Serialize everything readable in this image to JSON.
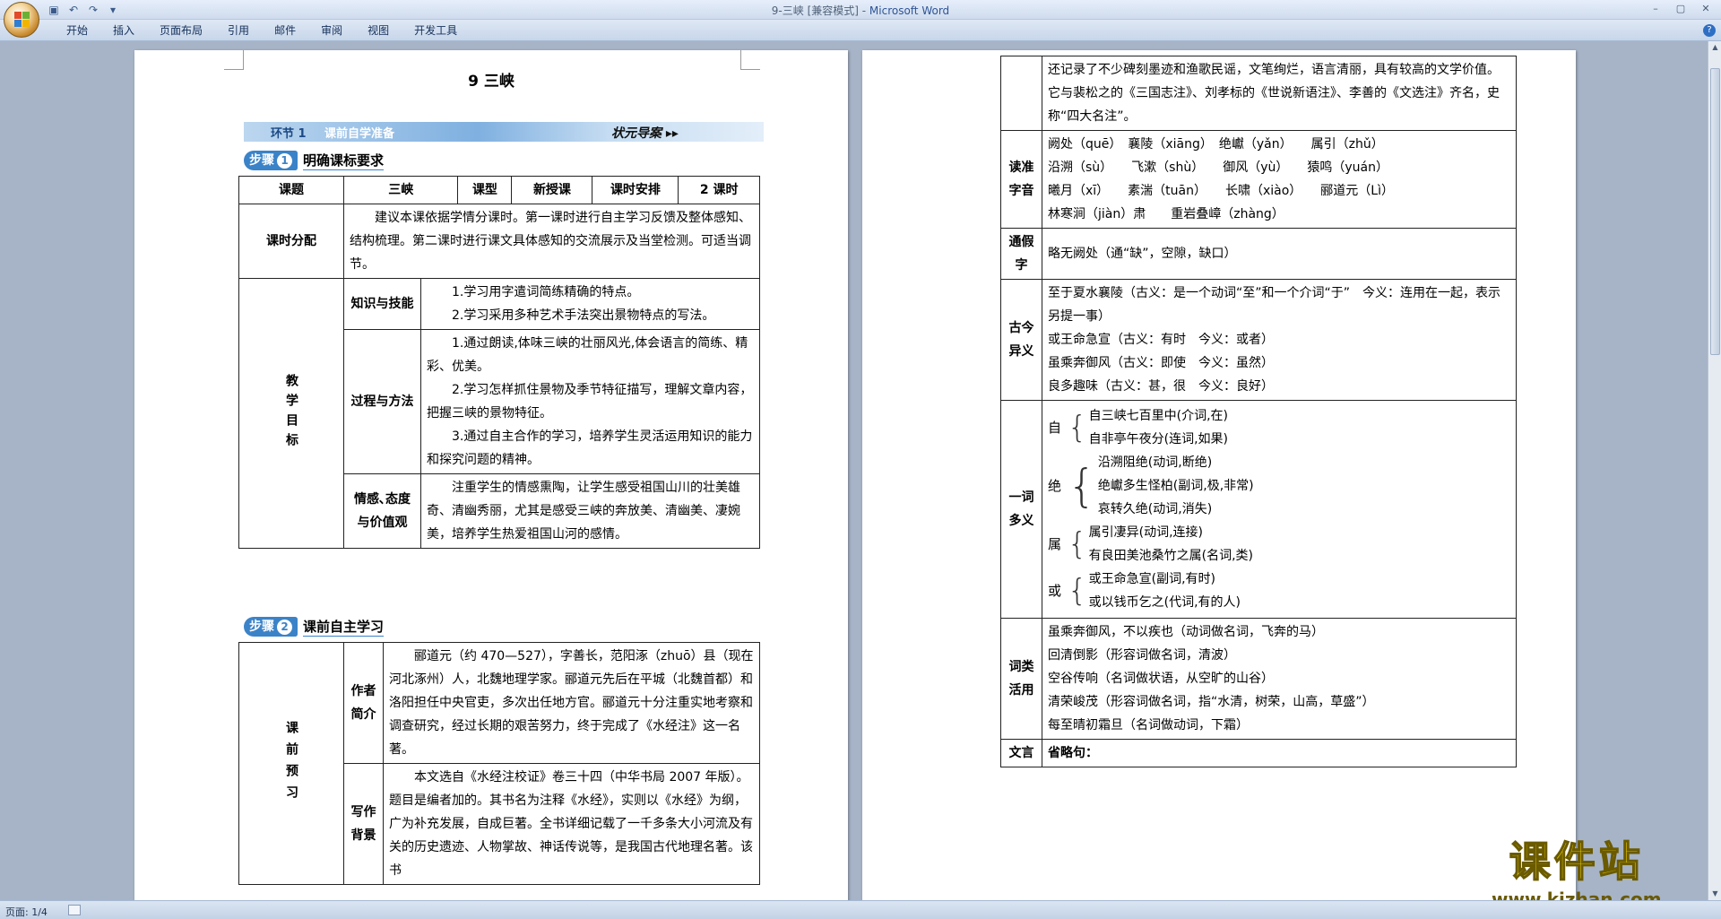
{
  "window": {
    "title": "9-三峡 [兼容模式] - ",
    "app": "Microsoft Word"
  },
  "ribbon": {
    "tabs": [
      "开始",
      "插入",
      "页面布局",
      "引用",
      "邮件",
      "审阅",
      "视图",
      "开发工具"
    ]
  },
  "status": {
    "page": "页面: 1/4"
  },
  "page1": {
    "title": "9  三峡",
    "banner": {
      "seg": "环节",
      "num": "1",
      "name": "课前自学准备",
      "right": "状元导案 ▸▸"
    },
    "step1": {
      "label": "步骤",
      "num": "1",
      "title": "明确课标要求"
    },
    "step2": {
      "label": "步骤",
      "num": "2",
      "title": "课前自主学习"
    },
    "t1": {
      "h1": "课题",
      "v1": "三峡",
      "h2": "课型",
      "v2": "新授课",
      "h3": "课时安排",
      "v3": "2 课时",
      "fen_label": "课时分配",
      "fen_text": "建议本课依据学情分课时。第一课时进行自主学习反馈及整体感知、结构梳理。第二课时进行课文具体感知的交流展示及当堂检测。可适当调节。",
      "goal_label": "教学目标",
      "k_label": "知识与技能",
      "k1": "1.学习用字遣词简练精确的特点。",
      "k2": "2.学习采用多种艺术手法突出景物特点的写法。",
      "p_label": "过程与方法",
      "p1": "1.通过朗读,体味三峡的壮丽风光,体会语言的简练、精彩、优美。",
      "p2": "2.学习怎样抓住景物及季节特征描写，理解文章内容，把握三峡的景物特征。",
      "p3": "3.通过自主合作的学习，培养学生灵活运用知识的能力和探究问题的精神。",
      "e_label": "情感､态度与价值观",
      "e1": "注重学生的情感熏陶，让学生感受祖国山川的壮美雄奇、清幽秀丽，尤其是感受三峡的奔放美、清幽美、凄婉美，培养学生热爱祖国山河的感情。"
    },
    "t2": {
      "pre_label": "课前预习",
      "a_label": "作者简介",
      "a_text": "郦道元（约 470—527），字善长，范阳涿（zhuō）县（现在河北涿州）人，北魏地理学家。郦道元先后在平城（北魏首都）和洛阳担任中央官吏，多次出任地方官。郦道元十分注重实地考察和调查研究，经过长期的艰苦努力，终于完成了《水经注》这一名著。",
      "b_label": "写作背景",
      "b_text": "本文选自《水经注校证》卷三十四（中华书局 2007 年版）。题目是编者加的。其书名为注释《水经》，实则以《水经》为纲，广为补充发展，自成巨著。全书详细记载了一千多条大小河流及有关的历史遗迹、人物掌故、神话传说等，是我国古代地理名著。该书"
    }
  },
  "page2": {
    "cont": "还记录了不少碑刻墨迹和渔歌民谣，文笔绚烂，语言清丽，具有较高的文学价值。它与裴松之的《三国志注》、刘孝标的《世说新语注》、李善的《文选注》齐名，史称“四大名注”。",
    "dz_label": "读准字音",
    "dz": [
      "阙处（quē）　襄陵（xiāng）　绝巘（yǎn）　　属引（zhǔ）",
      "沿溯（sù）　　飞漱（shù）　　御风（yù）　　猿鸣（yuán）",
      "曦月（xī）　　素湍（tuān）　　长啸（xiào）　　郦道元（Lì）",
      "林寒涧（jiàn）肃　　重岩叠嶂（zhàng）"
    ],
    "tj_label": "通假字",
    "tj": "略无阙处（通“缺”，空隙，缺口）",
    "gj_label": "古今异义",
    "gj": [
      "至于夏水襄陵（古义：是一个动词“至”和一个介词“于”　今义：连用在一起，表示另提一事）",
      "或王命急宣（古义：有时　今义：或者）",
      "虽乘奔御风（古义：即使　今义：虽然）",
      "良多趣味（古义：甚，很　今义：良好）"
    ],
    "yc_label": "一词多义",
    "yc": [
      {
        "w": "自",
        "items": [
          "自三峡七百里中(介词,在)",
          "自非亭午夜分(连词,如果)"
        ]
      },
      {
        "w": "绝",
        "items": [
          "沿溯阻绝(动词,断绝)",
          "绝巘多生怪柏(副词,极,非常)",
          "哀转久绝(动词,消失)"
        ]
      },
      {
        "w": "属",
        "items": [
          "属引凄异(动词,连接)",
          "有良田美池桑竹之属(名词,类)"
        ]
      },
      {
        "w": "或",
        "items": [
          "或王命急宣(副词,有时)",
          "或以钱币乞之(代词,有的人)"
        ]
      }
    ],
    "cl_label": "词类活用",
    "cl": [
      "虽乘奔御风，不以疾也（动词做名词，飞奔的马）",
      "回清倒影（形容词做名词，清波）",
      "空谷传响（名词做状语，从空旷的山谷）",
      "清荣峻茂（形容词做名词，指“水清，树荣，山高，草盛”）",
      "每至晴初霜旦（名词做动词，下霜）"
    ],
    "wy_label": "文言",
    "wy": "省略句："
  },
  "watermark": {
    "big": "课件站",
    "url": "www.kjzhan.com"
  }
}
